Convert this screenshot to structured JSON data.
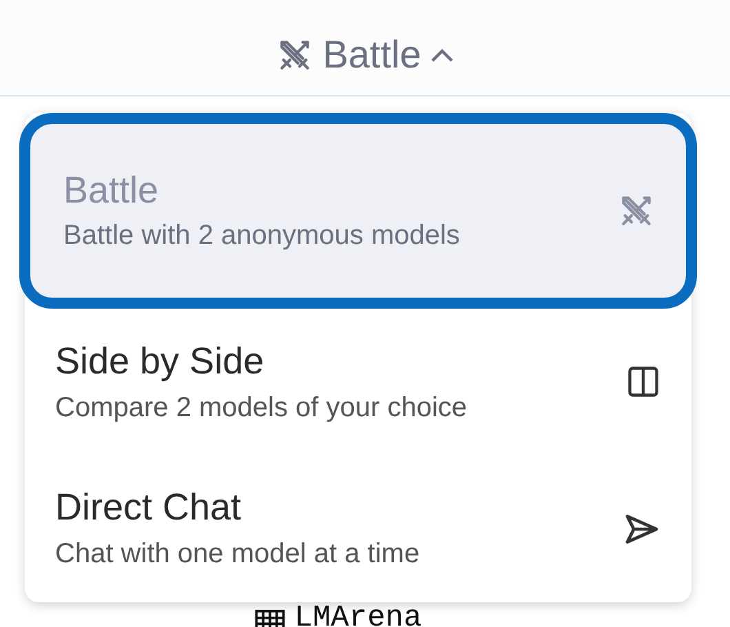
{
  "header": {
    "mode_label": "Battle",
    "expanded": true
  },
  "menu": [
    {
      "kind": "battle",
      "title": "Battle",
      "subtitle": "Battle with 2 anonymous models",
      "selected": true
    },
    {
      "kind": "side",
      "title": "Side by Side",
      "subtitle": "Compare 2 models of your choice",
      "selected": false
    },
    {
      "kind": "direct",
      "title": "Direct Chat",
      "subtitle": "Chat with one model at a time",
      "selected": false
    }
  ],
  "logo": {
    "text": "LMArena"
  }
}
